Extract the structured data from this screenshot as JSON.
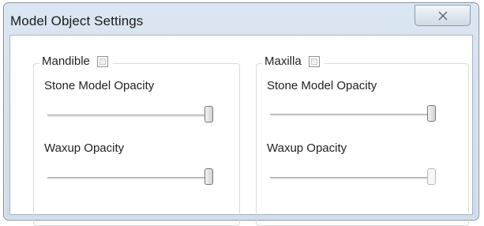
{
  "window": {
    "title": "Model Object Settings"
  },
  "groups": {
    "mandible": {
      "label": "Mandible",
      "checked": false,
      "stone_label": "Stone Model Opacity",
      "stone_value": 1.0,
      "waxup_label": "Waxup Opacity",
      "waxup_value": 1.0
    },
    "maxilla": {
      "label": "Maxilla",
      "checked": false,
      "stone_label": "Stone Model Opacity",
      "stone_value": 1.0,
      "waxup_label": "Waxup Opacity",
      "waxup_value": 1.0
    }
  },
  "icons": {
    "close": "close-icon"
  }
}
